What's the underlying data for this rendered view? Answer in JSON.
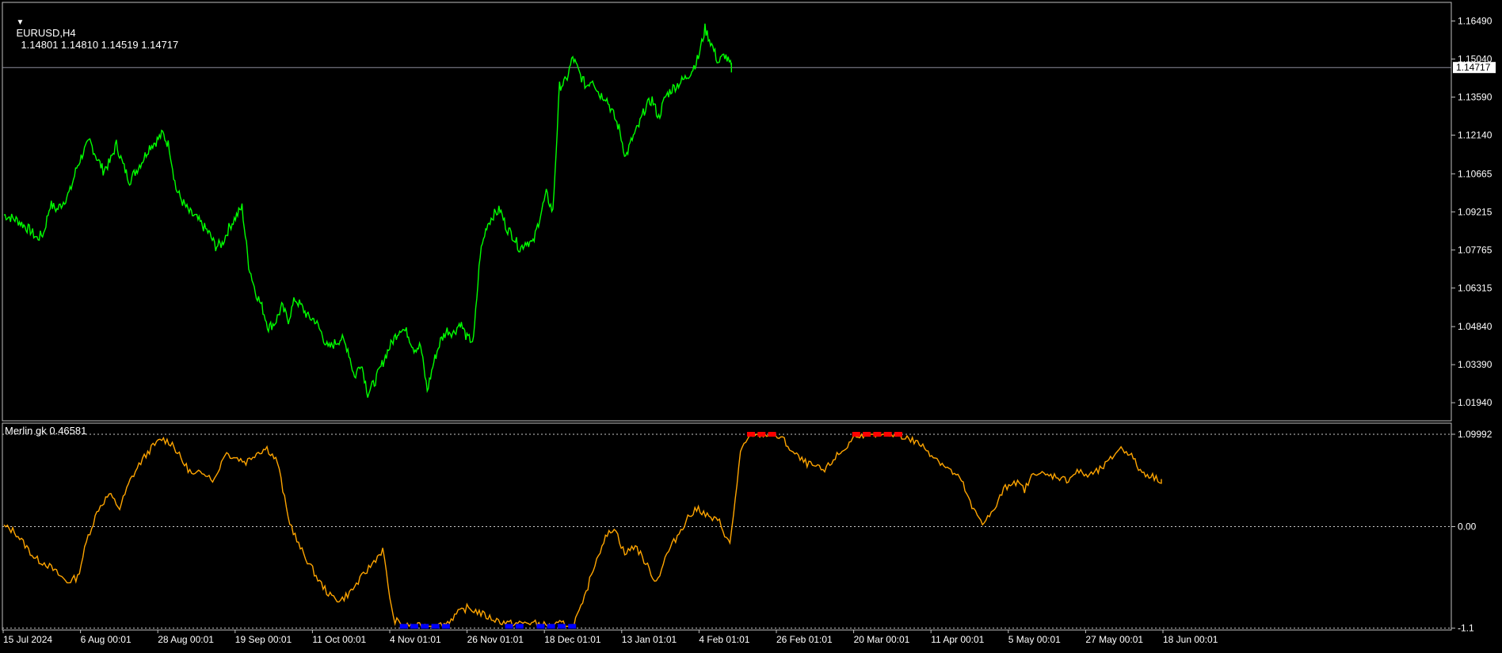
{
  "window": {
    "symbol_tf": "EURUSD,H4",
    "ohlc": "1.14801 1.14810 1.14519 1.14717",
    "indicator_label": "Merlin gk 0.46581"
  },
  "colors": {
    "background": "#000000",
    "price_line": "#00ff00",
    "indicator_line": "#ffa500",
    "overbought": "#ff0000",
    "oversold": "#0000ff",
    "axis_text": "#ffffff",
    "frame": "#c0c0c0"
  },
  "chart_data": [
    {
      "type": "line",
      "name_panel": "price",
      "ylim": [
        1.0125,
        1.172
      ],
      "y_ticks": [
        "1.16490",
        "1.15040",
        "1.13590",
        "1.12140",
        "1.10665",
        "1.09215",
        "1.07765",
        "1.06315",
        "1.04840",
        "1.03390",
        "1.01940"
      ],
      "current_price_label": "1.14717",
      "current_price": 1.14717,
      "x_ticks": [
        "15 Jul 2024",
        "6 Aug 00:01",
        "28 Aug 00:01",
        "19 Sep 00:01",
        "11 Oct 00:01",
        "4 Nov 01:01",
        "26 Nov 01:01",
        "18 Dec 01:01",
        "13 Jan 01:01",
        "4 Feb 01:01",
        "26 Feb 01:01",
        "20 Mar 00:01",
        "11 Apr 00:01",
        "5 May 00:01",
        "27 May 00:01",
        "18 Jun 00:01"
      ],
      "x": [
        0,
        2,
        4,
        6,
        8,
        10,
        12,
        14,
        16,
        18,
        20,
        22,
        24,
        26,
        28,
        30,
        32,
        34,
        36,
        38,
        40,
        42,
        44,
        46,
        48,
        50,
        52,
        54,
        56,
        58,
        60,
        62,
        64,
        66,
        68,
        70,
        72,
        74,
        76,
        78,
        80,
        82,
        84,
        86,
        88,
        90,
        92,
        94,
        96,
        98,
        100,
        102,
        104,
        106,
        108,
        110,
        112,
        114,
        116,
        118,
        120,
        122,
        124,
        126,
        128,
        130,
        132,
        134,
        136,
        138,
        140,
        142,
        144,
        146,
        148,
        150,
        152,
        154,
        156,
        158,
        160,
        162,
        164,
        166,
        168,
        170,
        172,
        174,
        176,
        178,
        180,
        182,
        184,
        186,
        188,
        190,
        192,
        194,
        196,
        198,
        200,
        202,
        204,
        206,
        208,
        210,
        212,
        214,
        216,
        218,
        220,
        222,
        224,
        226,
        228,
        230,
        232,
        234,
        236,
        238,
        240,
        242,
        244,
        246,
        248,
        250,
        252,
        254,
        256,
        258,
        260,
        262,
        264,
        266,
        268,
        270,
        272,
        274,
        276,
        278,
        280,
        282,
        284,
        286,
        288,
        290,
        292,
        294,
        296,
        298,
        300,
        302,
        304,
        306,
        308,
        310,
        312,
        314,
        316,
        318,
        320,
        322,
        324,
        326,
        328,
        330,
        332,
        334,
        336,
        338,
        340,
        342,
        344,
        346,
        348,
        350
      ],
      "y": [
        1.091,
        1.09,
        1.089,
        1.087,
        1.085,
        1.082,
        1.084,
        1.095,
        1.093,
        1.096,
        1.1,
        1.109,
        1.115,
        1.119,
        1.113,
        1.108,
        1.111,
        1.118,
        1.11,
        1.104,
        1.108,
        1.112,
        1.117,
        1.119,
        1.122,
        1.117,
        1.101,
        1.096,
        1.092,
        1.09,
        1.087,
        1.084,
        1.079,
        1.08,
        1.086,
        1.09,
        1.094,
        1.072,
        1.062,
        1.056,
        1.048,
        1.05,
        1.056,
        1.051,
        1.059,
        1.056,
        1.052,
        1.051,
        1.046,
        1.04,
        1.042,
        1.044,
        1.04,
        1.029,
        1.035,
        1.023,
        1.027,
        1.033,
        1.039,
        1.044,
        1.048,
        1.046,
        1.04,
        1.041,
        1.024,
        1.035,
        1.043,
        1.047,
        1.046,
        1.05,
        1.044,
        1.043,
        1.076,
        1.087,
        1.091,
        1.093,
        1.086,
        1.083,
        1.078,
        1.081,
        1.08,
        1.09,
        1.099,
        1.092,
        1.14,
        1.142,
        1.151,
        1.145,
        1.14,
        1.143,
        1.137,
        1.136,
        1.13,
        1.124,
        1.113,
        1.12,
        1.125,
        1.132,
        1.135,
        1.128,
        1.136,
        1.139,
        1.141,
        1.143,
        1.146,
        1.151,
        1.162,
        1.156,
        1.149,
        1.152,
        1.1472
      ]
    },
    {
      "type": "line",
      "name_panel": "indicator",
      "ylim": [
        -1.12,
        1.12
      ],
      "y_ticks": [
        "1.09992",
        "0.00",
        "-1.1"
      ],
      "levels": [
        1.0,
        0.0,
        -1.1
      ],
      "y": [
        0.0,
        -0.05,
        -0.2,
        -0.35,
        -0.4,
        -0.5,
        -0.6,
        -0.55,
        -0.1,
        0.2,
        0.35,
        0.2,
        0.5,
        0.7,
        0.85,
        0.95,
        0.9,
        0.7,
        0.55,
        0.6,
        0.5,
        0.8,
        0.75,
        0.7,
        0.8,
        0.85,
        0.7,
        0.1,
        -0.2,
        -0.4,
        -0.6,
        -0.75,
        -0.8,
        -0.7,
        -0.55,
        -0.4,
        -0.25,
        -1.0,
        -1.08,
        -1.08,
        -1.08,
        -1.08,
        -1.05,
        -0.95,
        -0.88,
        -0.92,
        -0.98,
        -1.02,
        -1.05,
        -1.05,
        -1.04,
        -1.06,
        -1.08,
        -1.05,
        -1.08,
        -0.85,
        -0.45,
        -0.15,
        0.0,
        -0.3,
        -0.2,
        -0.4,
        -0.6,
        -0.3,
        -0.1,
        0.1,
        0.2,
        0.1,
        0.05,
        -0.2,
        0.8,
        1.0,
        1.0,
        1.0,
        0.95,
        0.8,
        0.7,
        0.65,
        0.6,
        0.75,
        0.85,
        1.0,
        1.0,
        1.0,
        1.0,
        1.0,
        0.95,
        0.9,
        0.8,
        0.7,
        0.6,
        0.5,
        0.2,
        0.05,
        0.15,
        0.4,
        0.5,
        0.4,
        0.6,
        0.55,
        0.55,
        0.5,
        0.6,
        0.55,
        0.6,
        0.7,
        0.85,
        0.8,
        0.6,
        0.55,
        0.5
      ]
    }
  ]
}
